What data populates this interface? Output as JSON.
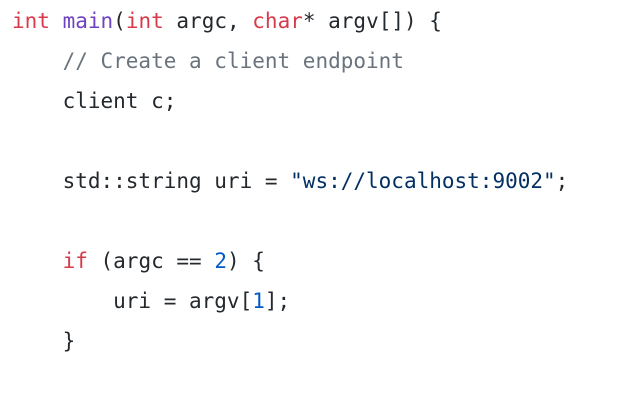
{
  "code": {
    "language": "cpp",
    "lines": [
      [
        {
          "t": "int",
          "k": "kw"
        },
        {
          "t": " ",
          "k": "plain"
        },
        {
          "t": "main",
          "k": "fn"
        },
        {
          "t": "(",
          "k": "plain"
        },
        {
          "t": "int",
          "k": "kw"
        },
        {
          "t": " argc, ",
          "k": "plain"
        },
        {
          "t": "char",
          "k": "kw"
        },
        {
          "t": "* argv[]) {",
          "k": "plain"
        }
      ],
      [
        {
          "t": "    ",
          "k": "plain"
        },
        {
          "t": "// Create a client endpoint",
          "k": "cm"
        }
      ],
      [
        {
          "t": "    client c;",
          "k": "plain"
        }
      ],
      [],
      [
        {
          "t": "    std::string uri = ",
          "k": "plain"
        },
        {
          "t": "\"ws://localhost:9002\"",
          "k": "str"
        },
        {
          "t": ";",
          "k": "plain"
        }
      ],
      [],
      [
        {
          "t": "    ",
          "k": "plain"
        },
        {
          "t": "if",
          "k": "kw"
        },
        {
          "t": " (argc == ",
          "k": "plain"
        },
        {
          "t": "2",
          "k": "num"
        },
        {
          "t": ") {",
          "k": "plain"
        }
      ],
      [
        {
          "t": "        uri = argv[",
          "k": "plain"
        },
        {
          "t": "1",
          "k": "num"
        },
        {
          "t": "];",
          "k": "plain"
        }
      ],
      [
        {
          "t": "    }",
          "k": "plain"
        }
      ]
    ]
  },
  "colors": {
    "keyword": "#d73a49",
    "function": "#6f42c1",
    "comment": "#6a737d",
    "number": "#005cc5",
    "string": "#032f62",
    "text": "#24292e",
    "background": "#ffffff"
  }
}
